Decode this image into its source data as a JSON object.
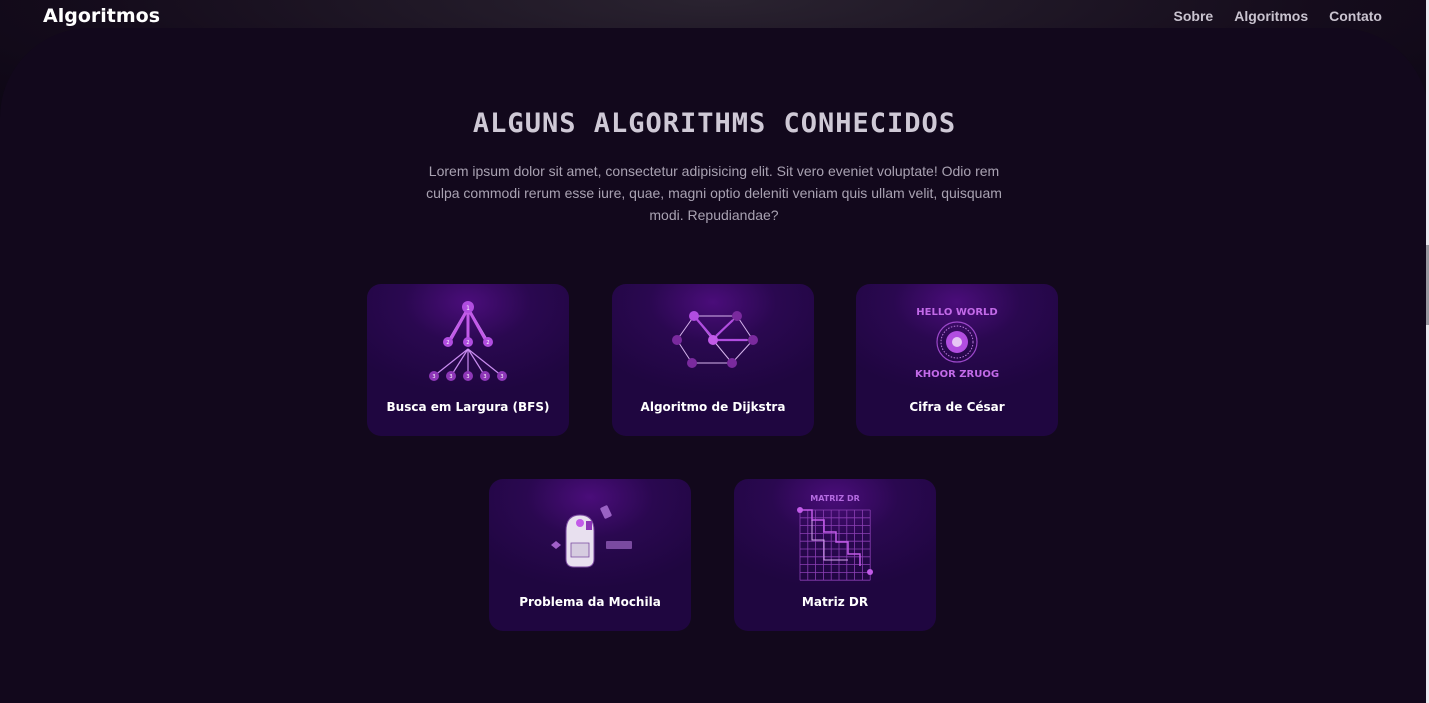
{
  "header": {
    "logo": "Algoritmos",
    "nav": [
      {
        "label": "Sobre"
      },
      {
        "label": "Algoritmos"
      },
      {
        "label": "Contato"
      }
    ]
  },
  "section": {
    "title": "ALGUNS ALGORITHMS CONHECIDOS",
    "description": "Lorem ipsum dolor sit amet, consectetur adipisicing elit. Sit vero eveniet voluptate! Odio rem culpa commodi rerum esse iure, quae, magni optio deleniti veniam quis ullam velit, quisquam modi. Repudiandae?"
  },
  "cards": [
    {
      "label": "Busca em Largura (BFS)",
      "icon": "bfs-tree-icon"
    },
    {
      "label": "Algoritmo de Dijkstra",
      "icon": "graph-network-icon"
    },
    {
      "label": "Cifra de César",
      "icon": "cipher-wheel-icon",
      "art_top": "HELLO WORLD",
      "art_bottom": "KHOOR ZRUOG"
    },
    {
      "label": "Problema da Mochila",
      "icon": "backpack-icon"
    },
    {
      "label": "Matriz DR",
      "icon": "grid-maze-icon",
      "art_title": "MATRIZ DR"
    }
  ],
  "colors": {
    "background": "#12081c",
    "card": "#2a0850",
    "accent": "#b14de0",
    "title": "#cfc9d6"
  }
}
